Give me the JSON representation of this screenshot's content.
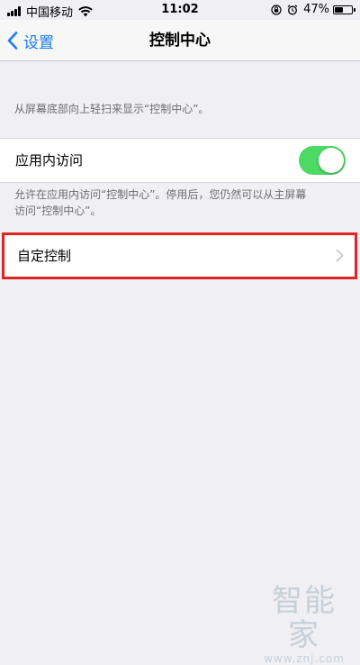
{
  "status_bar": {
    "carrier": "中国移动",
    "time": "11:02",
    "battery_percent": "47%"
  },
  "nav": {
    "back_label": "设置",
    "title": "控制中心"
  },
  "description_1": "从屏幕底部向上轻扫来显示“控制中心”。",
  "in_app_access": {
    "label": "应用内访问",
    "toggle_on": true,
    "accent_color": "#4cd964"
  },
  "description_2_lines": [
    "允许在应用内访问“控制中心”。停用后，您仍然可以从主屏幕",
    "访问“控制中心”。"
  ],
  "customize": {
    "label": "自定控制",
    "highlight_color": "#e02424"
  },
  "watermark": {
    "brand": "智能家",
    "url": "www.znj.com"
  }
}
